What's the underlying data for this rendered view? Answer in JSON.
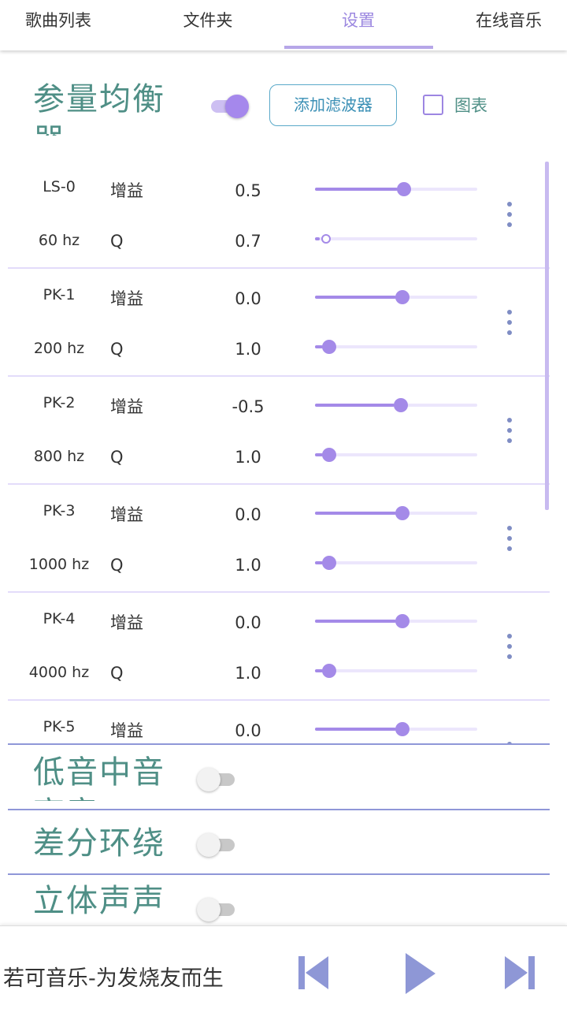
{
  "tabs": [
    {
      "label": "歌曲列表",
      "active": false
    },
    {
      "label": "文件夹",
      "active": false
    },
    {
      "label": "设置",
      "active": true
    },
    {
      "label": "在线音乐",
      "active": false
    }
  ],
  "colors": {
    "accent": "#a48ae8",
    "title": "#4f8f86",
    "control": "#8f97d8"
  },
  "equalizer": {
    "title": "参量均衡器",
    "enabled": true,
    "add_filter_label": "添加滤波器",
    "chart_label": "图表",
    "chart_checked": false,
    "gain_label": "增益",
    "q_label": "Q",
    "filters": [
      {
        "name": "LS-0",
        "freq": "60 hz",
        "gain": "0.5",
        "q": "0.7",
        "gain_fraction": 0.51,
        "q_fraction": 0.03
      },
      {
        "name": "PK-1",
        "freq": "200 hz",
        "gain": "0.0",
        "q": "1.0",
        "gain_fraction": 0.5,
        "q_fraction": 0.05
      },
      {
        "name": "PK-2",
        "freq": "800 hz",
        "gain": "-0.5",
        "q": "1.0",
        "gain_fraction": 0.49,
        "q_fraction": 0.05
      },
      {
        "name": "PK-3",
        "freq": "1000 hz",
        "gain": "0.0",
        "q": "1.0",
        "gain_fraction": 0.5,
        "q_fraction": 0.05
      },
      {
        "name": "PK-4",
        "freq": "4000 hz",
        "gain": "0.0",
        "q": "1.0",
        "gain_fraction": 0.5,
        "q_fraction": 0.05
      },
      {
        "name": "PK-5",
        "freq": "",
        "gain": "0.0",
        "q": "",
        "gain_fraction": 0.5,
        "q_fraction": 0.05
      }
    ]
  },
  "sections": [
    {
      "title": "低音中音高音",
      "enabled": false
    },
    {
      "title": "差分环绕",
      "enabled": false
    },
    {
      "title": "立体声声场",
      "enabled": false
    }
  ],
  "player": {
    "song": "若可音乐-为发烧友而生",
    "prev_icon": "skip-previous-icon",
    "play_icon": "play-icon",
    "next_icon": "skip-next-icon"
  }
}
